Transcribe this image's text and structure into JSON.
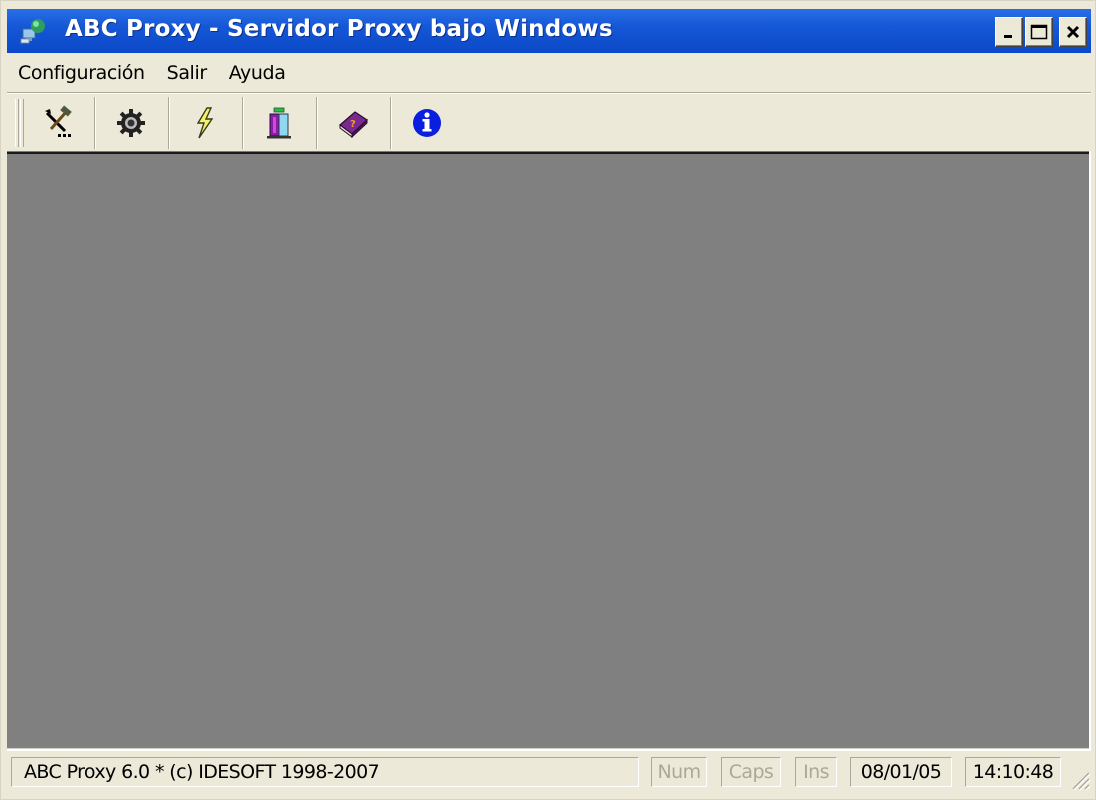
{
  "window": {
    "title": "ABC Proxy - Servidor Proxy bajo Windows",
    "app_icon": "network-computers-icon",
    "controls": {
      "minimize": "_",
      "maximize": "□",
      "close": "×"
    }
  },
  "menubar": {
    "items": [
      {
        "label": "Configuración"
      },
      {
        "label": "Salir"
      },
      {
        "label": "Ayuda"
      }
    ]
  },
  "toolbar": {
    "buttons": [
      {
        "icon": "tools-icon",
        "tooltip": ""
      },
      {
        "icon": "gear-icon",
        "tooltip": ""
      },
      {
        "icon": "lightning-icon",
        "tooltip": ""
      },
      {
        "icon": "building-icon",
        "tooltip": ""
      },
      {
        "icon": "help-book-icon",
        "tooltip": ""
      },
      {
        "icon": "info-icon",
        "tooltip": ""
      }
    ]
  },
  "statusbar": {
    "main_text": "ABC Proxy 6.0 * (c) IDESOFT 1998-2007",
    "num": "Num",
    "caps": "Caps",
    "ins": "Ins",
    "date": "08/01/05",
    "time": "14:10:48"
  },
  "colors": {
    "titlebar": "#0b49c8",
    "client_area": "#808080",
    "chrome": "#ece9d8",
    "info_blue": "#0a1ee0"
  }
}
